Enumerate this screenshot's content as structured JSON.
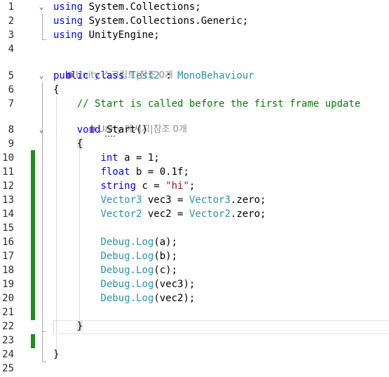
{
  "line_numbers": [
    "1",
    "2",
    "3",
    "4",
    "5",
    "6",
    "7",
    "8",
    "9",
    "10",
    "11",
    "12",
    "13",
    "14",
    "15",
    "16",
    "17",
    "18",
    "19",
    "20",
    "21",
    "22",
    "23",
    "24",
    "25"
  ],
  "code": {
    "l1_kw": "using",
    "l1_ns": " System.Collections;",
    "l2_kw": "using",
    "l2_ns": " System.Collections.Generic;",
    "l3_kw": "using",
    "l3_ns": " UnityEngine;",
    "lens_class": "Unity 스크립트|참조 0개",
    "l5_kw1": "public",
    "l5_kw2": "class",
    "l5_name": "Test2",
    "l5_colon": " : ",
    "l5_base": "MonoBehaviour",
    "l6": "{",
    "l7_comment": "// Start is called before the first frame update",
    "lens_method": "Unity 메시지|참조 0개",
    "l8_kw": "void",
    "l8_name": "Start",
    "l8_parens": "()",
    "l9": "{",
    "l10_kw": "int",
    "l10_rest": " a = 1;",
    "l11_kw": "float",
    "l11_rest": " b = 0.1f;",
    "l12_kw": "string",
    "l12_mid": " c = ",
    "l12_str": "\"hi\"",
    "l12_end": ";",
    "l13_t1": "Vector3",
    "l13_mid": " vec3 = ",
    "l13_t2": "Vector3",
    "l13_end": ".zero;",
    "l14_t1": "Vector2",
    "l14_mid": " vec2 = ",
    "l14_t2": "Vector2",
    "l14_end": ".zero;",
    "l16_t": "Debug",
    "l16_m": ".Log",
    "l16_a": "(a);",
    "l17_t": "Debug",
    "l17_m": ".Log",
    "l17_a": "(b);",
    "l18_t": "Debug",
    "l18_m": ".Log",
    "l18_a": "(c);",
    "l19_t": "Debug",
    "l19_m": ".Log",
    "l19_a": "(vec3);",
    "l20_t": "Debug",
    "l20_m": ".Log",
    "l20_a": "(vec2);",
    "l22": "}",
    "l24": "}"
  },
  "icons": {
    "fold": "chevron-down-icon",
    "lens": "unity-cube-icon"
  },
  "colors": {
    "keyword": "#0000ff",
    "type": "#2b91af",
    "string": "#a31515",
    "comment": "#008000",
    "change_bar": "#1e8f1e"
  }
}
